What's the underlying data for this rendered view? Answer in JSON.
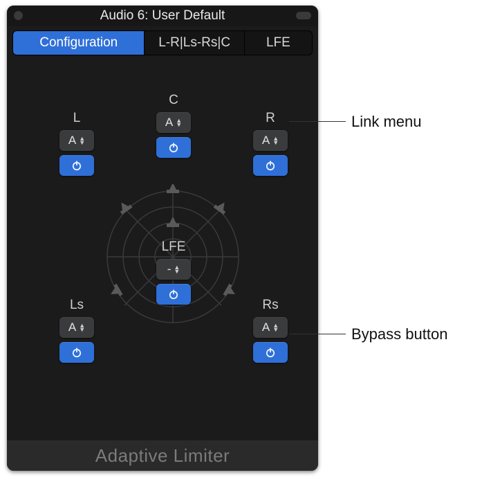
{
  "window": {
    "title": "Audio 6: User Default"
  },
  "tabs": [
    {
      "label": "Configuration",
      "active": true
    },
    {
      "label": "L-R|Ls-Rs|C",
      "active": false
    },
    {
      "label": "LFE",
      "active": false
    }
  ],
  "channels": {
    "L": {
      "label": "L",
      "link": "A"
    },
    "C": {
      "label": "C",
      "link": "A"
    },
    "R": {
      "label": "R",
      "link": "A"
    },
    "Ls": {
      "label": "Ls",
      "link": "A"
    },
    "Rs": {
      "label": "Rs",
      "link": "A"
    },
    "LFE": {
      "label": "LFE",
      "link": "-"
    }
  },
  "footer": {
    "plugin_name": "Adaptive Limiter"
  },
  "callouts": {
    "link_menu": "Link menu",
    "bypass_button": "Bypass button"
  }
}
